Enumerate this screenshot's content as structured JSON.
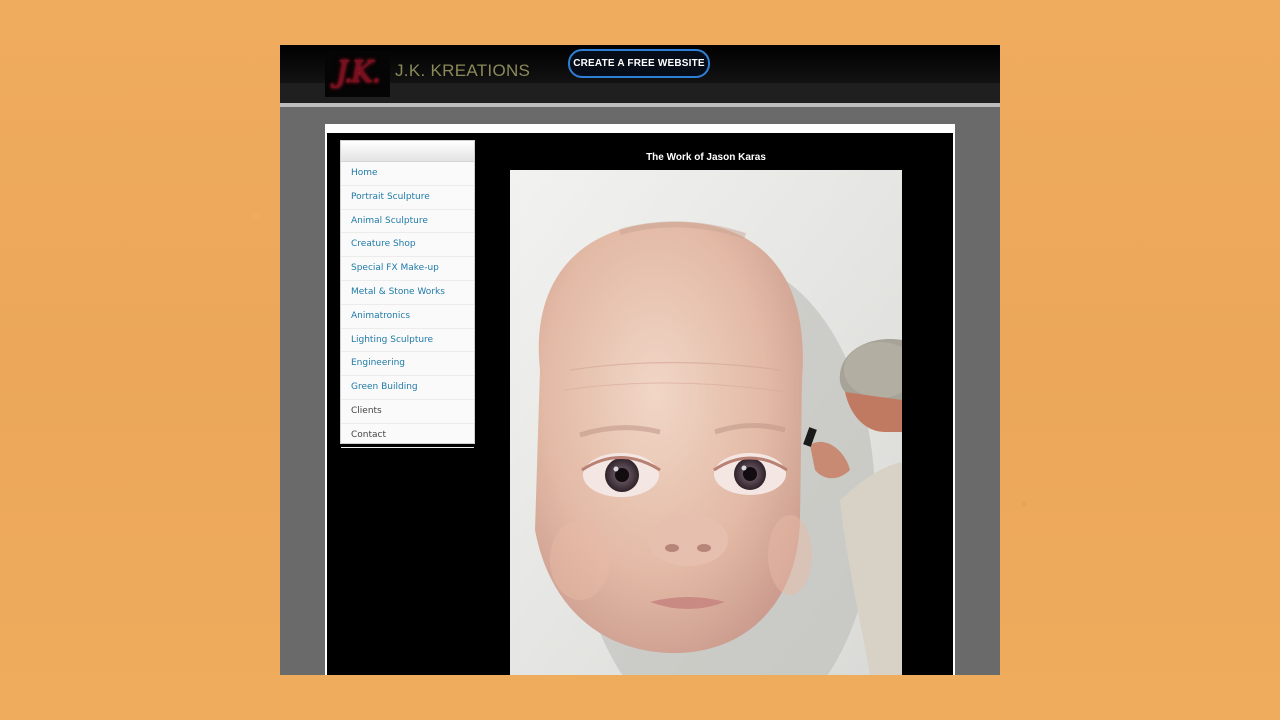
{
  "header": {
    "logo_text": "J.K.",
    "brand": "J.K. KREATIONS",
    "cta_label": "CREATE A FREE WEBSITE"
  },
  "content": {
    "title": "The Work of Jason Karas"
  },
  "nav": {
    "items": [
      {
        "label": "Home",
        "color": "#1f7aa8"
      },
      {
        "label": "Portrait Sculpture",
        "color": "#1f7aa8"
      },
      {
        "label": "Animal Sculpture",
        "color": "#1f7aa8"
      },
      {
        "label": "Creature Shop",
        "color": "#1f7aa8"
      },
      {
        "label": "Special FX Make-up",
        "color": "#1f7aa8"
      },
      {
        "label": "Metal & Stone Works",
        "color": "#1f7aa8"
      },
      {
        "label": "Animatronics",
        "color": "#1f7aa8"
      },
      {
        "label": "Lighting Sculpture",
        "color": "#1f7aa8"
      },
      {
        "label": "Engineering",
        "color": "#1f7aa8"
      },
      {
        "label": "Green Building",
        "color": "#1f7aa8"
      },
      {
        "label": "Clients",
        "color": "#444444"
      },
      {
        "label": "Contact",
        "color": "#444444"
      }
    ]
  },
  "colors": {
    "frame_background": "#eea95a",
    "cta_border": "#2e7fd6",
    "nav_link": "#1f7aa8"
  }
}
